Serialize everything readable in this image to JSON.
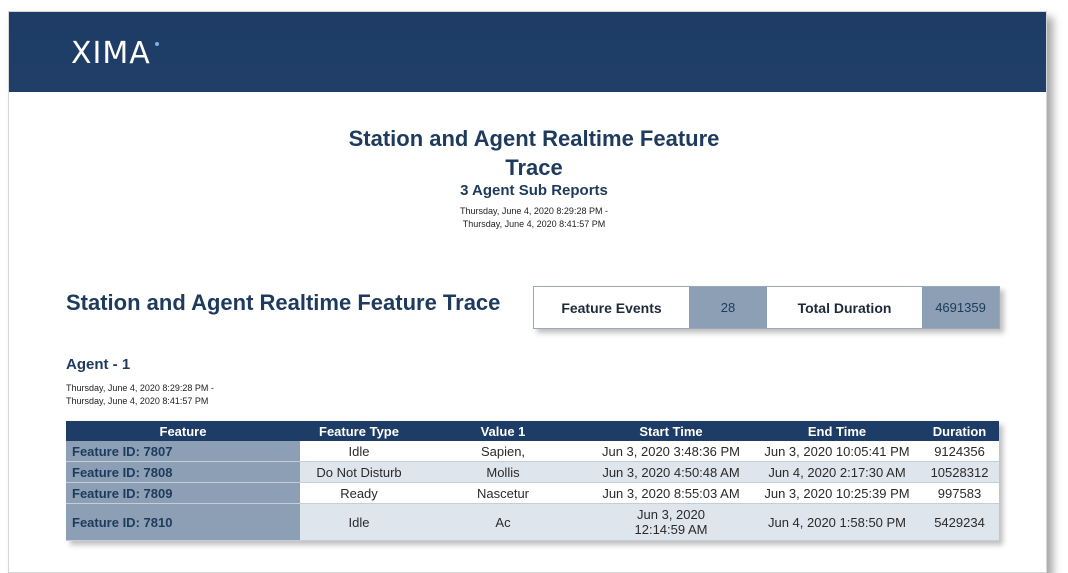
{
  "logo": {
    "text": "XIMA"
  },
  "report": {
    "title": "Station and Agent Realtime Feature Trace",
    "subtitle": "3 Agent Sub Reports",
    "range_start": "Thursday, June 4, 2020 8:29:28 PM -",
    "range_end": "Thursday, June 4, 2020 8:41:57 PM"
  },
  "section": {
    "title": "Station and Agent Realtime Feature Trace",
    "agent": "Agent - 1",
    "range_start": "Thursday, June 4, 2020 8:29:28 PM -",
    "range_end": "Thursday, June 4, 2020 8:41:57 PM"
  },
  "summary": {
    "feature_events_label": "Feature Events",
    "feature_events_value": "28",
    "total_duration_label": "Total Duration",
    "total_duration_value": "4691359"
  },
  "table": {
    "headers": [
      "Feature",
      "Feature Type",
      "Value 1",
      "Start Time",
      "End Time",
      "Duration"
    ],
    "rows": [
      {
        "feature": "Feature ID: 7807",
        "type": "Idle",
        "value1": "Sapien,",
        "start": "Jun 3, 2020 3:48:36 PM",
        "end": "Jun 3, 2020 10:05:41 PM",
        "duration": "9124356"
      },
      {
        "feature": "Feature ID: 7808",
        "type": "Do Not Disturb",
        "value1": "Mollis",
        "start": "Jun 3, 2020 4:50:48 AM",
        "end": "Jun 4, 2020 2:17:30 AM",
        "duration": "10528312"
      },
      {
        "feature": "Feature ID: 7809",
        "type": "Ready",
        "value1": "Nascetur",
        "start": "Jun 3, 2020 8:55:03 AM",
        "end": "Jun 3, 2020 10:25:39 PM",
        "duration": "997583"
      },
      {
        "feature": "Feature ID: 7810",
        "type": "Idle",
        "value1": "Ac",
        "start": "Jun 3, 2020 12:14:59 AM",
        "end": "Jun 4, 2020 1:58:50 PM",
        "duration": "5429234"
      }
    ]
  }
}
